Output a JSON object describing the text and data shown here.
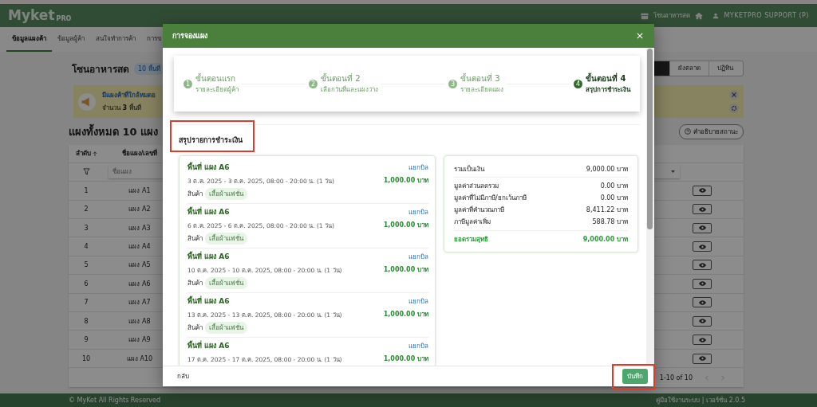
{
  "app_header": {
    "logo": "Myket",
    "logo_sub": "PRO",
    "zone": "โซนอาหารสด",
    "user": "MYKETPRO SUPPORT (P)"
  },
  "tabs": [
    {
      "label": "ข้อมูลแผงค้า",
      "selected": true
    },
    {
      "label": "ข้อมูลผู้ค้า",
      "selected": false
    },
    {
      "label": "สนใจทำการค้า",
      "selected": false
    },
    {
      "label": "การข",
      "selected": false
    }
  ],
  "zone": {
    "title": "โซนอาหารสด",
    "badge": "10 พื้นที่"
  },
  "view_buttons": [
    {
      "selected": true
    },
    {
      "label": "ผังตลาด",
      "selected": false
    },
    {
      "label": "ปฏิทิน",
      "selected": false
    }
  ],
  "alert": {
    "title": "มีแผงค้าที่ใกล้หมดอ",
    "text": "จำนวน **3** พื้นที่"
  },
  "stalls_heading": "แผงทั้งหมด 10 แผง",
  "status_help_button": "คำอธิบายสถานะ",
  "table": {
    "columns": [
      "ลำดับ",
      "ชื่อแผง/เลขที่"
    ],
    "filter_placeholder": "ชื่อแผง",
    "rows": [
      {
        "no": "1",
        "name": "แผง A1"
      },
      {
        "no": "2",
        "name": "แผง A2"
      },
      {
        "no": "3",
        "name": "แผง A3"
      },
      {
        "no": "4",
        "name": "แผง A4"
      },
      {
        "no": "5",
        "name": "แผง A5"
      },
      {
        "no": "6",
        "name": "แผง A6"
      },
      {
        "no": "7",
        "name": "แผง A7"
      },
      {
        "no": "8",
        "name": "แผง A8"
      },
      {
        "no": "9",
        "name": "แผง A9"
      },
      {
        "no": "10",
        "name": "แผง A10"
      }
    ]
  },
  "pagination": {
    "range": "1-10 of 10"
  },
  "footer": {
    "copyright": "© MyKet All Rights Reserved",
    "links": "คู่มือใช้งานระบบ | เวอร์ชั่น 2.0.5"
  },
  "modal": {
    "title": "การจองแผง",
    "steps": [
      {
        "number": "1",
        "title": "ขั้นตอนแรก",
        "subtitle": "รายละเอียดผู้ค้า",
        "selected": false
      },
      {
        "number": "2",
        "title": "ขั้นตอนที่ 2",
        "subtitle": "เลือกวันที่และแผงว่าง",
        "selected": false
      },
      {
        "number": "3",
        "title": "ขั้นตอนที่ 3",
        "subtitle": "รายละเอียดแผง",
        "selected": false
      },
      {
        "number": "4",
        "title": "ขั้นตอนที่ 4",
        "subtitle": "สรุปการชำระเงิน",
        "selected": true
      }
    ],
    "section_title": "สรุปรายการชำระเงิน",
    "bookings": [
      {
        "title": "พื้นที่ แผง A6",
        "split_link": "แยกบิล",
        "dates": "3 ต.ค. 2025 - 3 ต.ค. 2025, 08:00 - 20:00 น. (1 วัน)",
        "price": "1,000.00 บาท",
        "product_label": "สินค้า",
        "product": "เสื้อผ้าแฟชั่น"
      },
      {
        "title": "พื้นที่ แผง A6",
        "split_link": "แยกบิล",
        "dates": "6 ต.ค. 2025 - 6 ต.ค. 2025, 08:00 - 20:00 น. (1 วัน)",
        "price": "1,000.00 บาท",
        "product_label": "สินค้า",
        "product": "เสื้อผ้าแฟชั่น"
      },
      {
        "title": "พื้นที่ แผง A6",
        "split_link": "แยกบิล",
        "dates": "10 ต.ค. 2025 - 10 ต.ค. 2025, 08:00 - 20:00 น. (1 วัน)",
        "price": "1,000.00 บาท",
        "product_label": "สินค้า",
        "product": "เสื้อผ้าแฟชั่น"
      },
      {
        "title": "พื้นที่ แผง A6",
        "split_link": "แยกบิล",
        "dates": "13 ต.ค. 2025 - 13 ต.ค. 2025, 08:00 - 20:00 น. (1 วัน)",
        "price": "1,000.00 บาท",
        "product_label": "สินค้า",
        "product": "เสื้อผ้าแฟชั่น"
      },
      {
        "title": "พื้นที่ แผง A6",
        "split_link": "แยกบิล",
        "dates": "17 ต.ค. 2025 - 17 ต.ค. 2025, 08:00 - 20:00 น. (1 วัน)",
        "price": "1,000.00 บาท"
      }
    ],
    "summary": [
      {
        "kind": "subtotal",
        "label": "รวมเป็นเงิน",
        "value": "9,000.00 บาท"
      },
      {
        "kind": "line",
        "label": "มูลค่าส่วนลดรวม",
        "value": "0.00 บาท"
      },
      {
        "kind": "line",
        "label": "มูลค่าที่ไม่มีภาษี/ยกเว้นภาษี",
        "value": "0.00 บาท"
      },
      {
        "kind": "line",
        "label": "มูลค่าที่คำนวณภาษี",
        "value": "8,411.22 บาท"
      },
      {
        "kind": "line",
        "label": "ภาษีมูลค่าเพิ่ม",
        "value": "588.78 บาท"
      },
      {
        "kind": "total",
        "label": "ยอดรวมสุทธิ",
        "value": "9,000.00 บาท"
      }
    ],
    "back_button": "กลับ",
    "save_button": "บันทึก"
  }
}
